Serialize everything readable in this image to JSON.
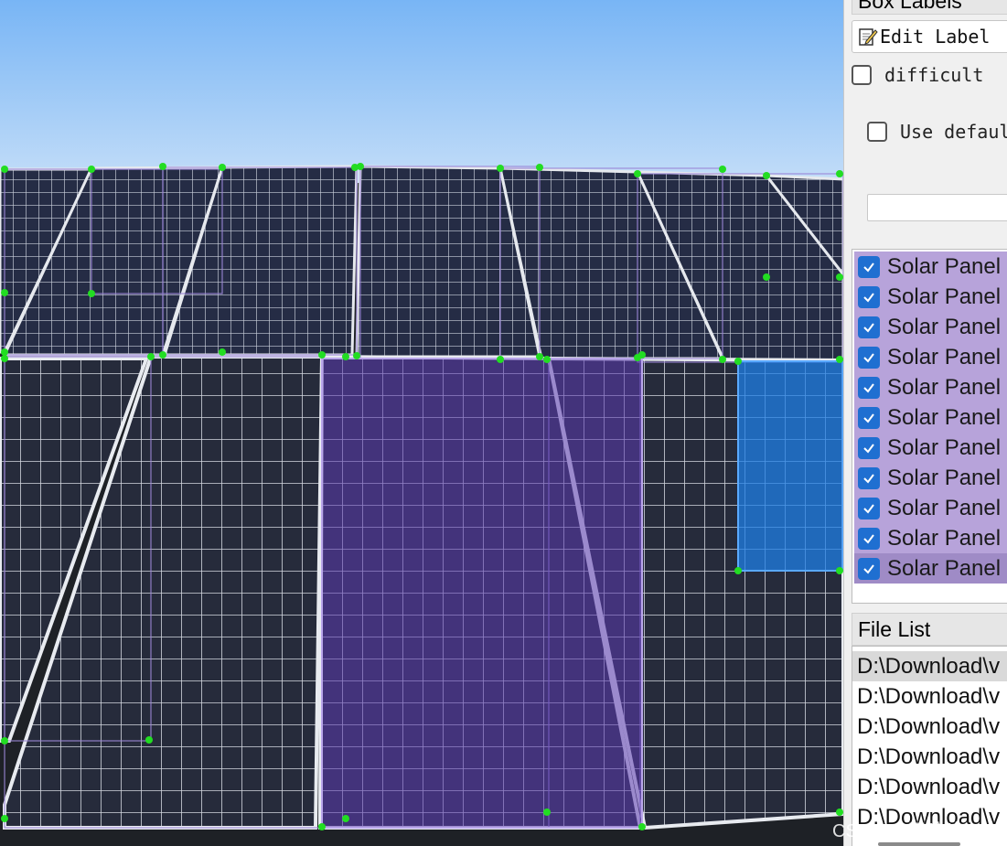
{
  "dock": {
    "box_labels_title": "Box Labels",
    "edit_label_button": "Edit Label",
    "difficult_label": "difficult",
    "use_default_label": "Use defaul",
    "default_label_value": "",
    "labels": [
      {
        "text": "Solar Panel",
        "checked": true
      },
      {
        "text": "Solar Panel",
        "checked": true
      },
      {
        "text": "Solar Panel",
        "checked": true
      },
      {
        "text": "Solar Panel",
        "checked": true
      },
      {
        "text": "Solar Panel",
        "checked": true
      },
      {
        "text": "Solar Panel",
        "checked": true
      },
      {
        "text": "Solar Panel",
        "checked": true
      },
      {
        "text": "Solar Panel",
        "checked": true
      },
      {
        "text": "Solar Panel",
        "checked": true
      },
      {
        "text": "Solar Panel",
        "checked": true
      },
      {
        "text": "Solar Panel",
        "checked": true
      }
    ],
    "file_list_title": "File List",
    "files": [
      "D:\\Download\\v",
      "D:\\Download\\v",
      "D:\\Download\\v",
      "D:\\Download\\v",
      "D:\\Download\\v",
      "D:\\Download\\v"
    ]
  },
  "watermark": "CSDN @王哈哈^_^",
  "colors": {
    "sky_top": "#7ab7f6",
    "sky_bottom": "#c5defa",
    "box_outline": "#9b86d6",
    "selected_box_fill": "#5b3bb0",
    "active_box_fill": "#1f7fe6",
    "vertex": "#22dd22",
    "label_item_bg": "#b7a3da",
    "checkbox_blue": "#1f6fd1"
  },
  "icons": {
    "edit": "edit-pencil-icon",
    "check": "check-mark-icon"
  }
}
